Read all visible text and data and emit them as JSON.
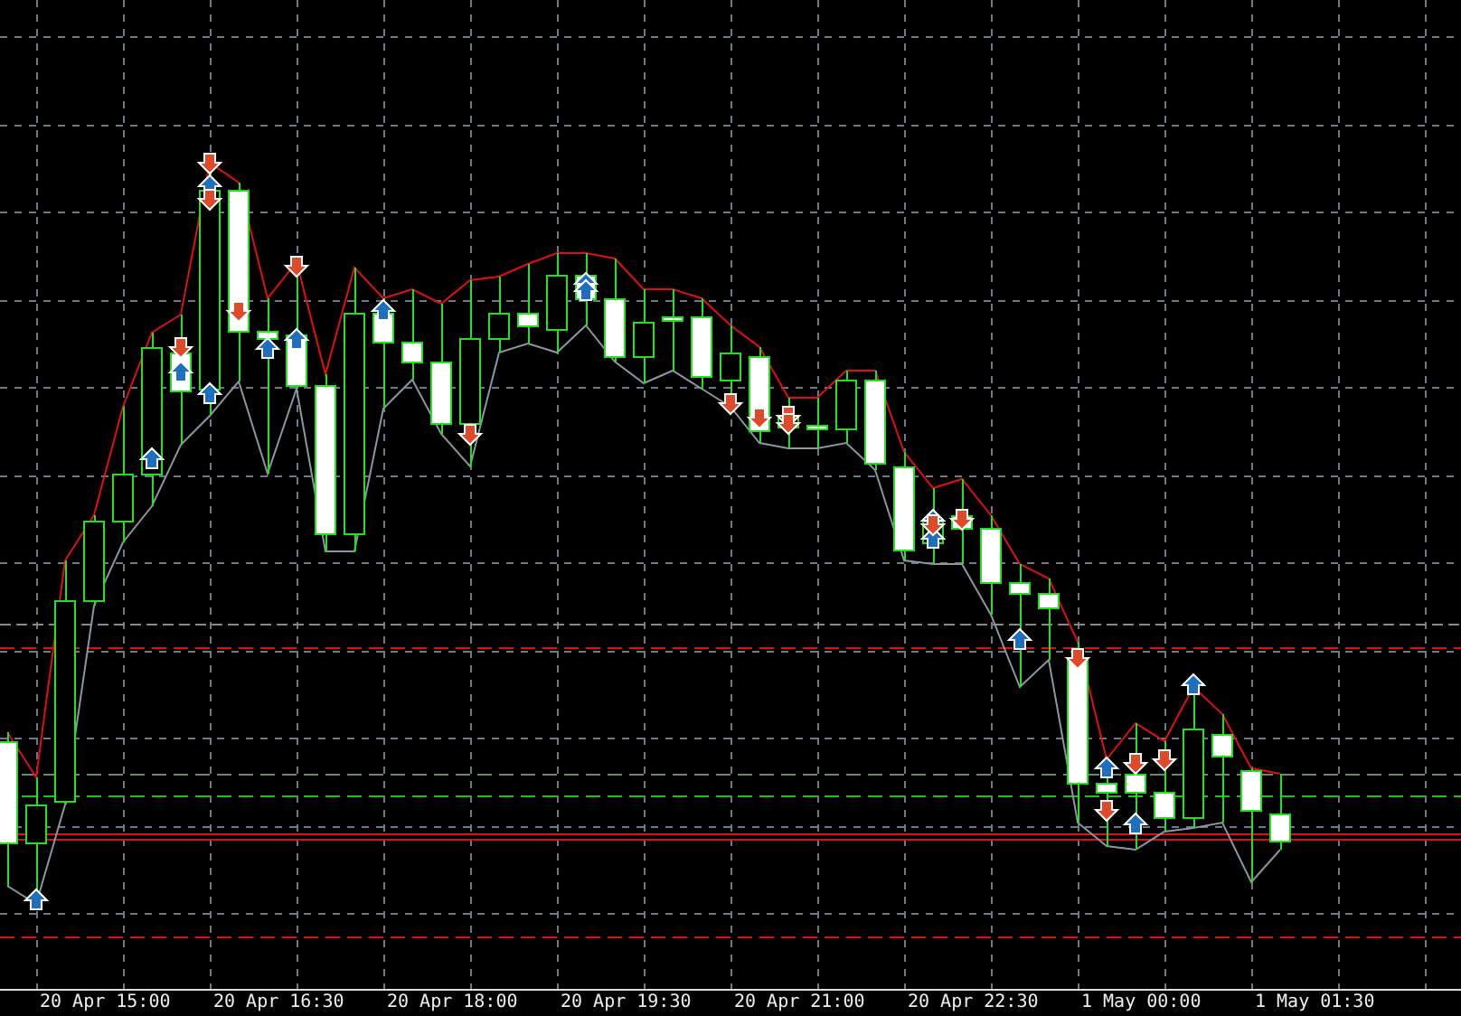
{
  "time_axis": {
    "labels": [
      "20 Apr 15:00",
      "20 Apr 16:30",
      "20 Apr 18:00",
      "20 Apr 19:30",
      "20 Apr 21:00",
      "20 Apr 22:30",
      "1 May 00:00",
      "1 May 01:30"
    ]
  }
}
